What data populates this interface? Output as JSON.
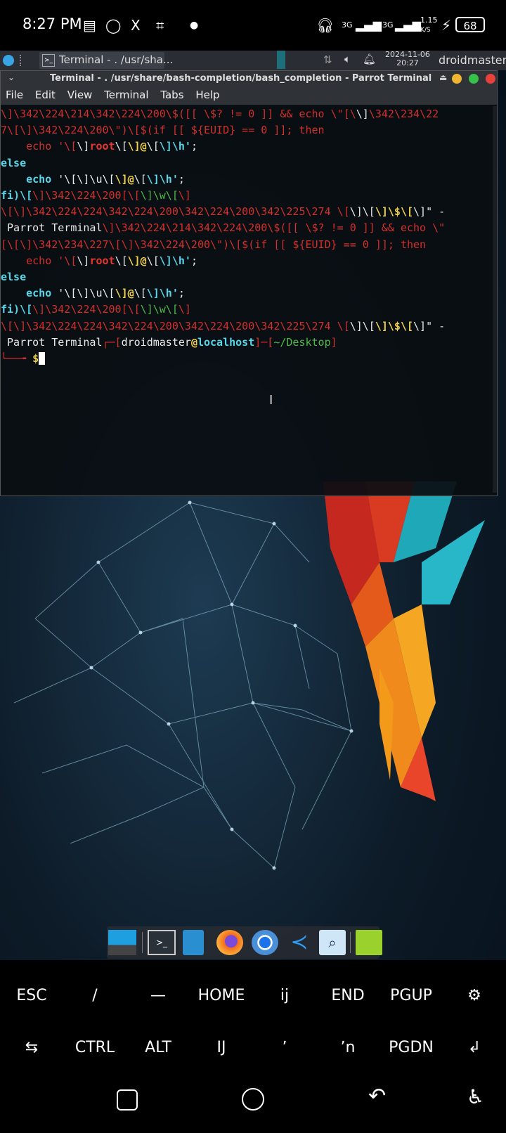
{
  "status_bar": {
    "time": "8:27 PM",
    "network_1": "3G",
    "network_2": "3G",
    "speed": "1.15",
    "speed_unit": "K/S",
    "battery": "68"
  },
  "taskbar": {
    "window_button_label": "Terminal - . /usr/sha...",
    "date": "2024-11-06",
    "clock": "20:27",
    "user": "droidmaster"
  },
  "terminal": {
    "title": "Terminal - . /usr/share/bash-completion/bash_completion - Parrot Terminal",
    "menu": [
      "File",
      "Edit",
      "View",
      "Terminal",
      "Tabs",
      "Help"
    ],
    "prompt": {
      "user": "droidmaster",
      "at": "@",
      "host": "localhost",
      "dir": "~/Desktop",
      "symbol": "$"
    }
  },
  "keyboard": {
    "row1": [
      "ESC",
      "/",
      "—",
      "HOME",
      "ij",
      "END",
      "PGUP",
      "⚙"
    ],
    "row2": [
      "⇆",
      "CTRL",
      "ALT",
      "IJ",
      "ʼ",
      "ʼn",
      "PGDN",
      "↲"
    ]
  },
  "dock": {
    "items": [
      "show-desktop",
      "terminal",
      "file-manager",
      "firefox",
      "chromium",
      "vscode",
      "search",
      "folder"
    ]
  },
  "colors": {
    "terminal_red": "#d3302c",
    "terminal_yellow": "#f0d24a",
    "terminal_cyan": "#56d6e8",
    "terminal_green": "#4fb84a"
  }
}
